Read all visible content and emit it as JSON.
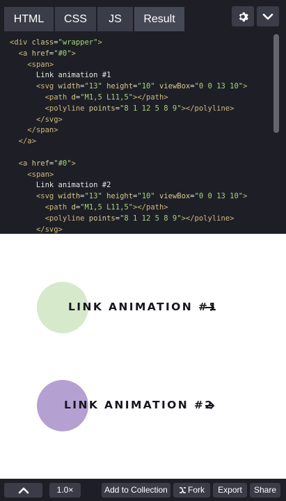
{
  "tabs": [
    {
      "label": "HTML"
    },
    {
      "label": "CSS"
    },
    {
      "label": "JS"
    },
    {
      "label": "Result"
    }
  ],
  "toolbar_icons": [
    "gear-icon",
    "chevron-down-icon"
  ],
  "code_lines": [
    [
      {
        "t": "tag",
        "v": "<div "
      },
      {
        "t": "attr",
        "v": "class"
      },
      {
        "t": "plain",
        "v": "="
      },
      {
        "t": "str",
        "v": "\"wrapper\""
      },
      {
        "t": "tag",
        "v": ">"
      }
    ],
    [
      {
        "t": "plain",
        "v": "  "
      },
      {
        "t": "tag",
        "v": "<a "
      },
      {
        "t": "attr",
        "v": "href"
      },
      {
        "t": "plain",
        "v": "="
      },
      {
        "t": "str",
        "v": "\"#0\""
      },
      {
        "t": "tag",
        "v": ">"
      }
    ],
    [
      {
        "t": "plain",
        "v": "    "
      },
      {
        "t": "tag",
        "v": "<span>"
      }
    ],
    [
      {
        "t": "plain",
        "v": "      Link animation #1"
      }
    ],
    [
      {
        "t": "plain",
        "v": "      "
      },
      {
        "t": "tag",
        "v": "<svg "
      },
      {
        "t": "attr",
        "v": "width"
      },
      {
        "t": "plain",
        "v": "="
      },
      {
        "t": "str",
        "v": "\"13\""
      },
      {
        "t": "plain",
        "v": " "
      },
      {
        "t": "attr",
        "v": "height"
      },
      {
        "t": "plain",
        "v": "="
      },
      {
        "t": "str",
        "v": "\"10\""
      },
      {
        "t": "plain",
        "v": " "
      },
      {
        "t": "attr",
        "v": "viewBox"
      },
      {
        "t": "plain",
        "v": "="
      },
      {
        "t": "str",
        "v": "\"0 0 13 10\""
      },
      {
        "t": "tag",
        "v": ">"
      }
    ],
    [
      {
        "t": "plain",
        "v": "        "
      },
      {
        "t": "tag",
        "v": "<path "
      },
      {
        "t": "attr",
        "v": "d"
      },
      {
        "t": "plain",
        "v": "="
      },
      {
        "t": "str",
        "v": "\"M1,5 L11,5\""
      },
      {
        "t": "tag",
        "v": "></path>"
      }
    ],
    [
      {
        "t": "plain",
        "v": "        "
      },
      {
        "t": "tag",
        "v": "<polyline "
      },
      {
        "t": "attr",
        "v": "points"
      },
      {
        "t": "plain",
        "v": "="
      },
      {
        "t": "str",
        "v": "\"8 1 12 5 8 9\""
      },
      {
        "t": "tag",
        "v": "></polyline>"
      }
    ],
    [
      {
        "t": "plain",
        "v": "      "
      },
      {
        "t": "tag",
        "v": "</svg>"
      }
    ],
    [
      {
        "t": "plain",
        "v": "    "
      },
      {
        "t": "tag",
        "v": "</span>"
      }
    ],
    [
      {
        "t": "plain",
        "v": "  "
      },
      {
        "t": "tag",
        "v": "</a>"
      }
    ],
    [
      {
        "t": "plain",
        "v": ""
      }
    ],
    [
      {
        "t": "plain",
        "v": "  "
      },
      {
        "t": "tag",
        "v": "<a "
      },
      {
        "t": "attr",
        "v": "href"
      },
      {
        "t": "plain",
        "v": "="
      },
      {
        "t": "str",
        "v": "\"#0\""
      },
      {
        "t": "tag",
        "v": ">"
      }
    ],
    [
      {
        "t": "plain",
        "v": "    "
      },
      {
        "t": "tag",
        "v": "<span>"
      }
    ],
    [
      {
        "t": "plain",
        "v": "      Link animation #2"
      }
    ],
    [
      {
        "t": "plain",
        "v": "      "
      },
      {
        "t": "tag",
        "v": "<svg "
      },
      {
        "t": "attr",
        "v": "width"
      },
      {
        "t": "plain",
        "v": "="
      },
      {
        "t": "str",
        "v": "\"13\""
      },
      {
        "t": "plain",
        "v": " "
      },
      {
        "t": "attr",
        "v": "height"
      },
      {
        "t": "plain",
        "v": "="
      },
      {
        "t": "str",
        "v": "\"10\""
      },
      {
        "t": "plain",
        "v": " "
      },
      {
        "t": "attr",
        "v": "viewBox"
      },
      {
        "t": "plain",
        "v": "="
      },
      {
        "t": "str",
        "v": "\"0 0 13 10\""
      },
      {
        "t": "tag",
        "v": ">"
      }
    ],
    [
      {
        "t": "plain",
        "v": "        "
      },
      {
        "t": "tag",
        "v": "<path "
      },
      {
        "t": "attr",
        "v": "d"
      },
      {
        "t": "plain",
        "v": "="
      },
      {
        "t": "str",
        "v": "\"M1,5 L11,5\""
      },
      {
        "t": "tag",
        "v": "></path>"
      }
    ],
    [
      {
        "t": "plain",
        "v": "        "
      },
      {
        "t": "tag",
        "v": "<polyline "
      },
      {
        "t": "attr",
        "v": "points"
      },
      {
        "t": "plain",
        "v": "="
      },
      {
        "t": "str",
        "v": "\"8 1 12 5 8 9\""
      },
      {
        "t": "tag",
        "v": "></polyline>"
      }
    ],
    [
      {
        "t": "plain",
        "v": "      "
      },
      {
        "t": "tag",
        "v": "</svg>"
      }
    ]
  ],
  "result": {
    "links": [
      {
        "label": "LINK ANIMATION #1",
        "circle_color": "#d6e9cb"
      },
      {
        "label": "LINK ANIMATION #2",
        "circle_color": "#b4a1d2"
      }
    ],
    "arrow_icon": "arrow-right-icon"
  },
  "bottom_bar": {
    "zoom": "1.0×",
    "add_to_collection": "Add to Collection",
    "fork": "Fork",
    "export": "Export",
    "share": "Share"
  },
  "colors": {
    "editor_bg": "#1e1f26",
    "button_bg": "#3a3d48",
    "code_tag": "#cfb97a",
    "code_string": "#a8d27a"
  }
}
